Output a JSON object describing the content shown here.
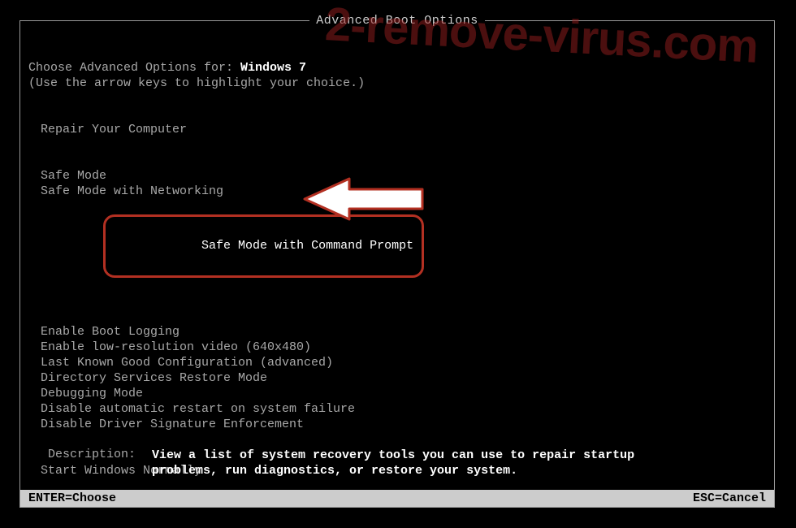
{
  "watermark": "2-remove-virus.com",
  "title": "Advanced Boot Options",
  "prompt_prefix": "Choose Advanced Options for: ",
  "os_name": "Windows 7",
  "hint": "(Use the arrow keys to highlight your choice.)",
  "groups": [
    {
      "items": [
        "Repair Your Computer"
      ]
    },
    {
      "items": [
        "Safe Mode",
        "Safe Mode with Networking",
        "Safe Mode with Command Prompt"
      ],
      "highlight_index": 2
    },
    {
      "items": [
        "Enable Boot Logging",
        "Enable low-resolution video (640x480)",
        "Last Known Good Configuration (advanced)",
        "Directory Services Restore Mode",
        "Debugging Mode",
        "Disable automatic restart on system failure",
        "Disable Driver Signature Enforcement"
      ]
    },
    {
      "items": [
        "Start Windows Normally"
      ]
    }
  ],
  "description_label": "Description:",
  "description_text": "View a list of system recovery tools you can use to repair startup problems, run diagnostics, or restore your system.",
  "footer_left": "ENTER=Choose",
  "footer_right": "ESC=Cancel"
}
